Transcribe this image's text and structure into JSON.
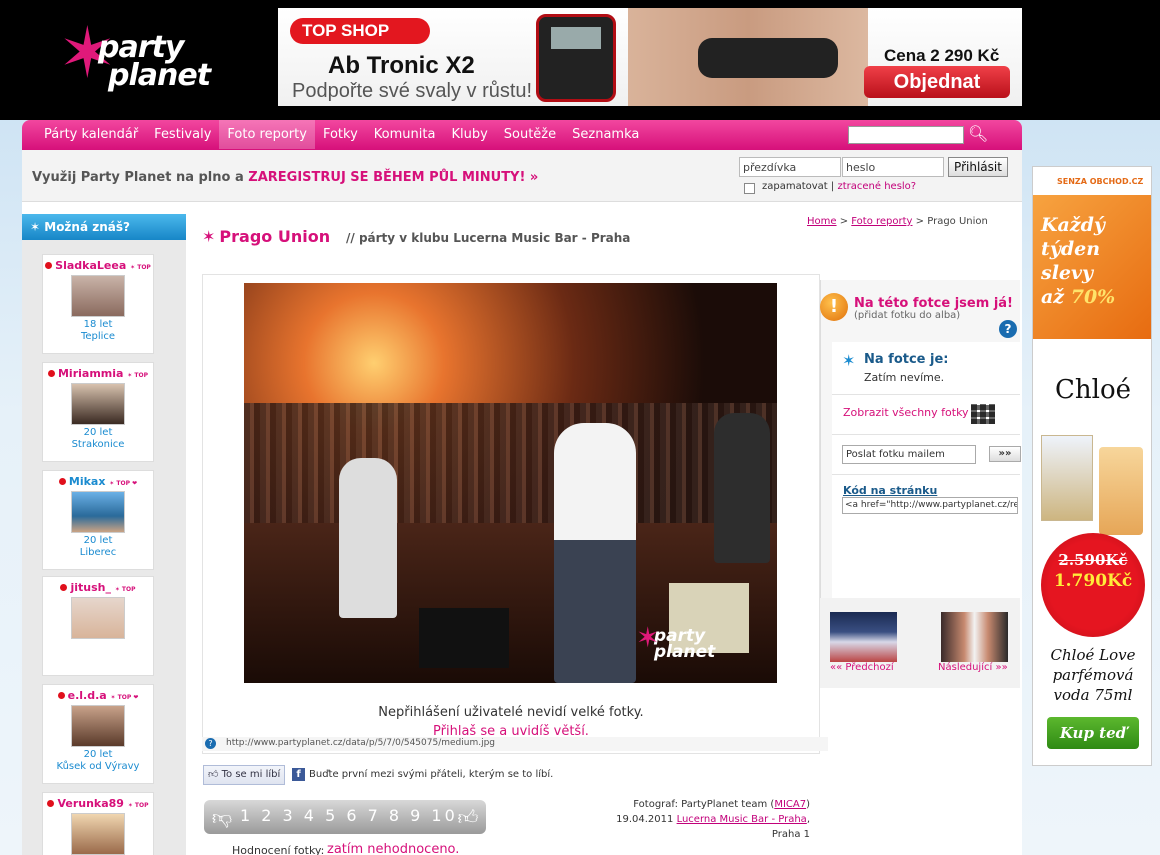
{
  "header": {
    "logo_line1": "party",
    "logo_line2": "planet"
  },
  "top_banner": {
    "shop": "TOP SHOP",
    "product": "Ab Tronic X2",
    "tagline": "Podpořte své svaly v růstu!",
    "price": "Cena 2 290 Kč",
    "order_label": "Objednat"
  },
  "nav": {
    "items": [
      "Párty kalendář",
      "Festivaly",
      "Foto reporty",
      "Fotky",
      "Komunita",
      "Kluby",
      "Soutěže",
      "Seznamka"
    ],
    "active": "Foto reporty",
    "search_placeholder": ""
  },
  "register_bar": {
    "text": "Využij Party Planet na plno a ",
    "highlight": "ZAREGISTRUJ SE BĚHEM PŮL MINUTY! »",
    "nick_placeholder": "přezdívka",
    "pass_placeholder": "heslo",
    "login_label": "Přihlásit",
    "remember_label": "zapamatovat",
    "lost_password": "ztracené heslo?"
  },
  "sidebar": {
    "title": "Možná znáš?",
    "users": [
      {
        "name": "SladkaLeea",
        "age": "18 let",
        "city": "Teplice"
      },
      {
        "name": "Miriammia",
        "age": "20 let",
        "city": "Strakonice"
      },
      {
        "name": "Mikax",
        "age": "20 let",
        "city": "Liberec"
      },
      {
        "name": "jitush_",
        "age": "",
        "city": ""
      },
      {
        "name": "e.l.d.a",
        "age": "20 let",
        "city": "Kůsek od Výravy"
      },
      {
        "name": "Verunka89",
        "age": "",
        "city": ""
      }
    ]
  },
  "page": {
    "title": "Prago Union",
    "subtitle": "// párty v klubu Lucerna Music Bar - Praha",
    "breadcrumb": {
      "home": "Home",
      "section": "Foto reporty",
      "current": "Prago Union"
    }
  },
  "photo": {
    "watermark_line1": "party",
    "watermark_line2": "planet",
    "note": "Nepřihlášení uživatelé nevidí velké fotky.",
    "login_prompt": "Přihlaš se a uvidíš větší.",
    "url": "http://www.partyplanet.cz/data/p/5/7/0/545075/medium.jpg"
  },
  "info_panel": {
    "tag_me_title": "Na této fotce jsem já!",
    "tag_me_sub": "(přidat fotku do alba)",
    "on_photo_title": "Na fotce je:",
    "on_photo_value": "Zatím nevíme.",
    "show_all": "Zobrazit všechny fotky",
    "mail_value": "Poslat fotku mailem",
    "mail_button": "»»",
    "code_label": "Kód na stránku",
    "code_value": "<a href=\"http://www.partyplanet.cz/re"
  },
  "pager": {
    "prev": "«« Předchozí",
    "next": "Následující »»"
  },
  "like": {
    "button": "To se mi líbí",
    "text": "Buďte první mezi svými přáteli, kterým se to líbí."
  },
  "rating": {
    "scale": "1 2 3 4 5 6 7 8 9 10",
    "label": "Hodnocení fotky:",
    "value": "zatím nehodnoceno."
  },
  "credit": {
    "photographer_label": "Fotograf: PartyPlanet team (",
    "photographer_link": "MICA7",
    "photographer_end": ")",
    "date": "19.04.2011",
    "venue": "Lucerna Music Bar - Praha",
    "city": "Praha 1"
  },
  "right_ad": {
    "logo": "SENZA OBCHOD.CZ",
    "line1": "Každý",
    "line2": "týden",
    "line3": "slevy",
    "line4": "až",
    "pct": "70%",
    "brand": "Chloé",
    "old_price": "2.590Kč",
    "new_price": "1.790Kč",
    "desc1": "Chloé Love",
    "desc2": "parfémová",
    "desc3": "voda 75ml",
    "buy": "Kup teď"
  },
  "colors": {
    "brand_pink": "#d6107a",
    "nav_blue": "#1a8bd0"
  }
}
